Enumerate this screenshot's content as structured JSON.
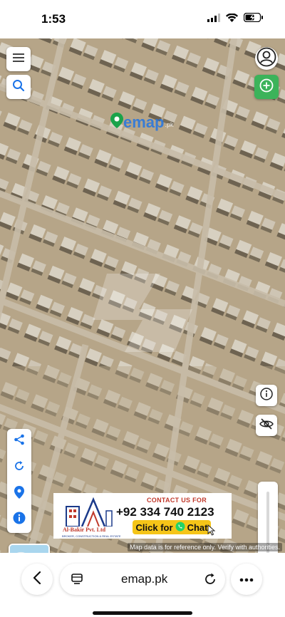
{
  "status_bar": {
    "time": "1:53",
    "icons": [
      "cellular-signal-icon",
      "wifi-icon",
      "battery-charging-icon"
    ]
  },
  "map": {
    "watermark": {
      "brand": "emap",
      "suffix": ".pk"
    },
    "attribution": "Map data is for reference only. Verify with authorities.",
    "controls": {
      "top_left": [
        "menu-icon",
        "search-icon"
      ],
      "top_right": [
        "user-account-icon",
        "add-plus-icon"
      ],
      "left_panel": [
        "share-icon",
        "refresh-icon",
        "location-pin-icon",
        "info-icon"
      ],
      "right_panel": [
        "info-icon",
        "visibility-off-icon"
      ]
    },
    "opacity_slider_level": 0.12,
    "accent_color": "#1a73e8",
    "add_button_color": "#3cb35a"
  },
  "ad": {
    "contact_label": "CONTACT US FOR",
    "phone": "+92 334 740 2123",
    "company": "Al-Bakir Pvt. Ltd",
    "tagline": "BROKER, CONSTRUCTION & REAL ESTATE",
    "cta_prefix": "Click for",
    "cta_suffix": "Chat",
    "cta_icon": "whatsapp-icon"
  },
  "browser": {
    "url": "emap.pk",
    "buttons": [
      "back-icon",
      "tabs-icon",
      "reload-icon",
      "more-icon"
    ]
  }
}
